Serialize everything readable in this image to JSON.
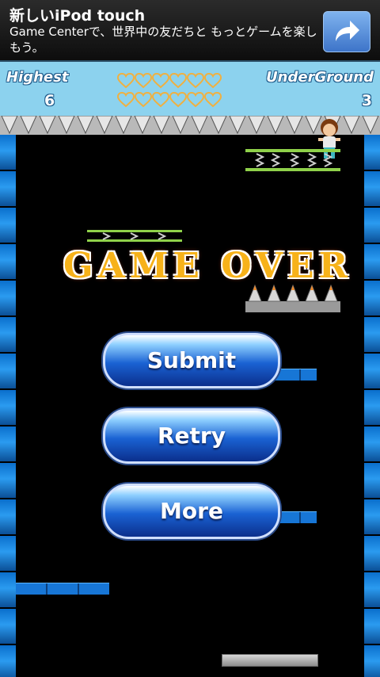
{
  "ad": {
    "title": "新しいiPod touch",
    "text": "Game Centerで、世界中の友だちと もっとゲームを楽しもう。",
    "share_icon": "share-arrow-icon"
  },
  "hud": {
    "highest_label": "Highest",
    "highest_value": "6",
    "underground_label": "UnderGround",
    "underground_value": "3",
    "lives_total": 12,
    "heart_color": "#f0b040"
  },
  "game": {
    "title": "GAME OVER"
  },
  "buttons": {
    "submit": "Submit",
    "retry": "Retry",
    "more": "More"
  },
  "colors": {
    "hud_bg": "#8cd2ee",
    "wall": "#2b9bf0",
    "button": "#1a62d3"
  }
}
